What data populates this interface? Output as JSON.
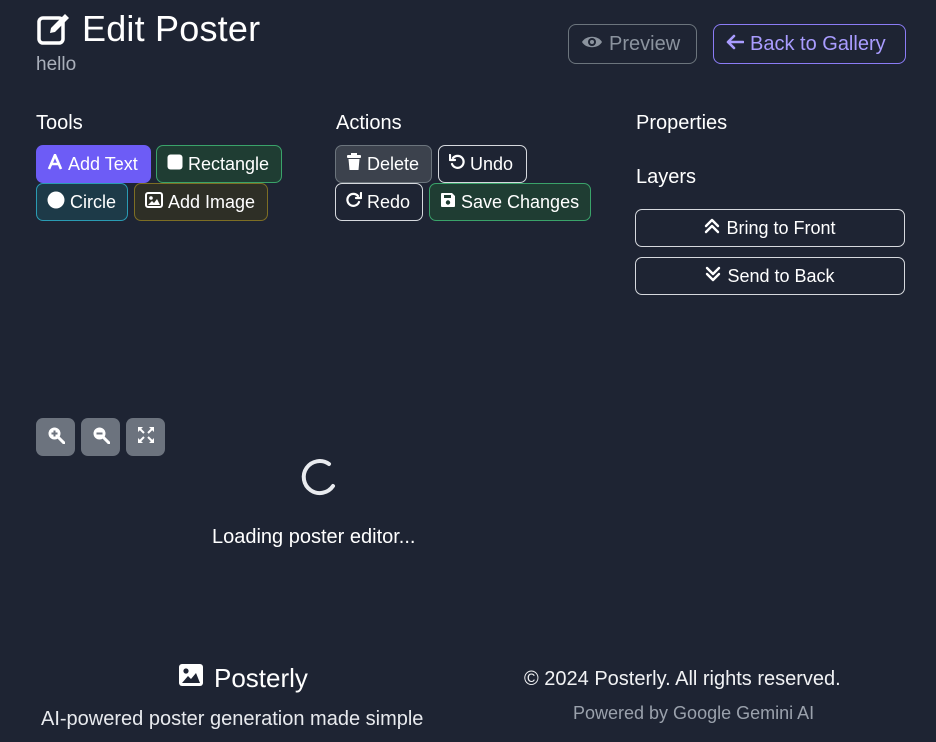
{
  "header": {
    "title": "Edit Poster",
    "subtitle": "hello",
    "preview_label": "Preview",
    "back_label": "Back to Gallery"
  },
  "tools": {
    "heading": "Tools",
    "add_text": "Add Text",
    "rectangle": "Rectangle",
    "circle": "Circle",
    "add_image": "Add Image"
  },
  "actions": {
    "heading": "Actions",
    "delete": "Delete",
    "undo": "Undo",
    "redo": "Redo",
    "save": "Save Changes"
  },
  "properties": {
    "heading": "Properties",
    "layers_heading": "Layers",
    "bring_front": "Bring to Front",
    "send_back": "Send to Back"
  },
  "canvas": {
    "loading_text": "Loading poster editor..."
  },
  "footer": {
    "brand": "Posterly",
    "tagline": "AI-powered poster generation made simple",
    "copyright": "© 2024 Posterly. All rights reserved.",
    "powered": "Powered by Google Gemini AI"
  },
  "colors": {
    "background": "#1e2433",
    "accent": "#6d5cf6",
    "success": "#3aa36a",
    "info": "#2a9bb3",
    "warning": "#7d6e24"
  },
  "icons": {
    "title": "edit-icon",
    "preview": "eye-icon",
    "back": "arrow-left-icon",
    "add_text": "font-icon",
    "rectangle": "square-icon",
    "circle": "circle-icon",
    "add_image": "image-icon",
    "delete": "trash-icon",
    "undo": "undo-icon",
    "redo": "redo-icon",
    "save": "save-icon",
    "bring_front": "double-chevron-up-icon",
    "send_back": "double-chevron-down-icon",
    "zoom_in": "zoom-in-icon",
    "zoom_out": "zoom-out-icon",
    "fit": "expand-icon",
    "brand": "image-icon"
  }
}
